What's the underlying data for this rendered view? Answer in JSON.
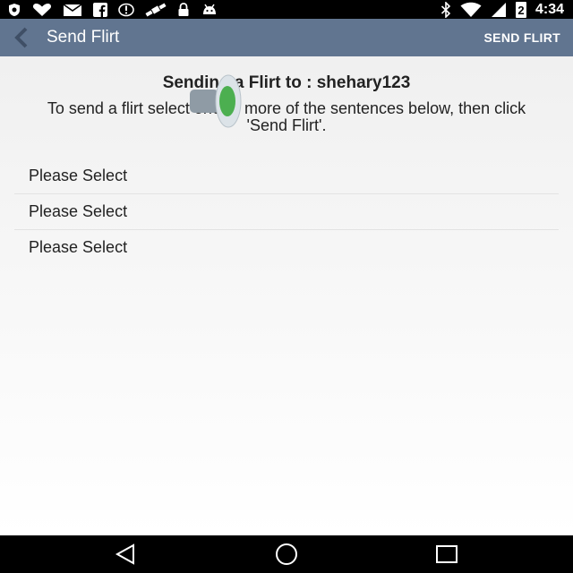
{
  "status_bar": {
    "time": "4:34",
    "battery_level": "2",
    "icons": [
      "shield-icon",
      "heart-icon",
      "mail-icon",
      "facebook-icon",
      "data-saver-icon",
      "satellite-icon",
      "lock-icon",
      "android-icon",
      "bluetooth-icon",
      "wifi-icon",
      "cell-signal-icon",
      "battery-icon"
    ]
  },
  "action_bar": {
    "title": "Send Flirt",
    "action_label": "SEND FLIRT",
    "background_color": "#617590"
  },
  "content": {
    "heading": "Sending a Flirt to : shehary123",
    "instructions": "To send a flirt select one or more of the sentences below, then click 'Send Flirt'."
  },
  "options": [
    {
      "label": "Please Select"
    },
    {
      "label": "Please Select"
    },
    {
      "label": "Please Select"
    }
  ],
  "nav_bar": {
    "buttons": [
      "back-icon",
      "home-icon",
      "recents-icon"
    ]
  }
}
